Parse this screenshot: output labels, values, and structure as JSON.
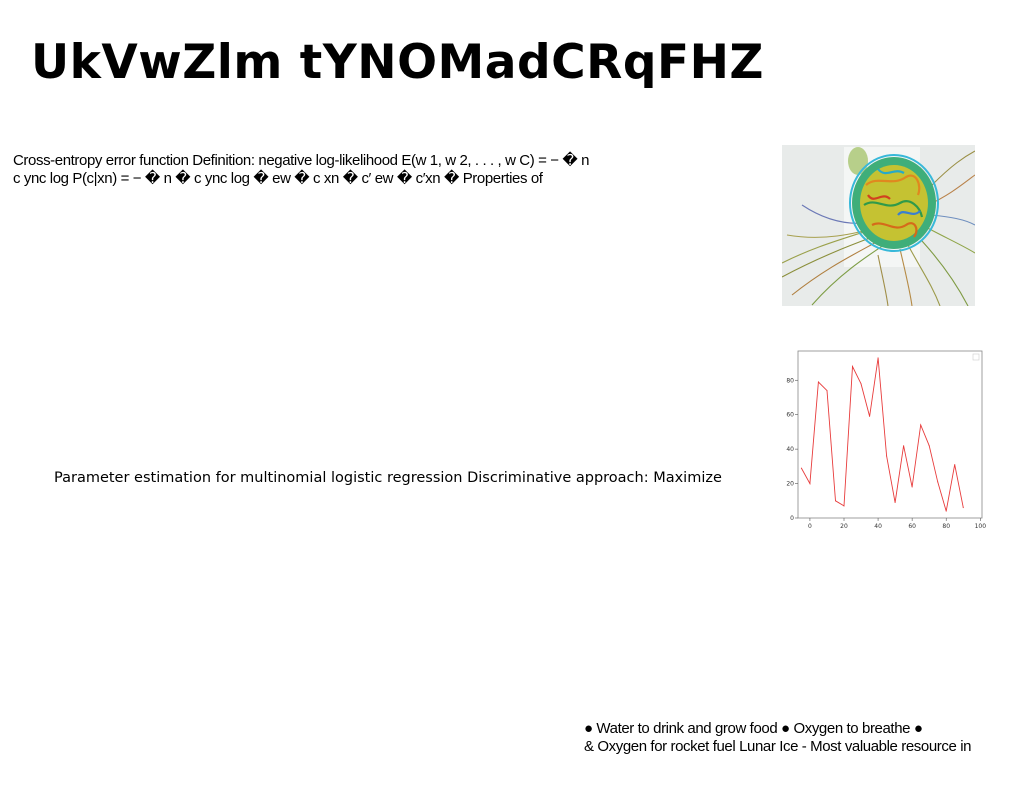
{
  "slide": {
    "title": "UkVwZlm tYNOMadCRqFHZ",
    "paragraph_1": {
      "line_1": "Cross-entropy error function Definition: negative log-likelihood E(w 1, w 2, . . . , w C) = − � n",
      "line_2": "c ync log P(c|xn) = − � n � c ync log � ew � c xn � c′ ew � c′xn � Properties of"
    },
    "paragraph_2": "Parameter estimation for multinomial logistic regression Discriminative approach: Maximize",
    "paragraph_3": {
      "line_1": "● Water to drink and grow food ● Oxygen to breathe ●",
      "line_2": "& Oxygen for rocket fuel Lunar Ice - Most valuable resource in"
    }
  },
  "chart_data": {
    "type": "line",
    "x": [
      -5,
      0,
      5,
      10,
      15,
      20,
      25,
      30,
      35,
      40,
      45,
      50,
      55,
      60,
      65,
      70,
      75,
      80,
      85,
      90,
      95,
      100
    ],
    "series": [
      {
        "values": [
          29,
          20,
          79,
          74,
          10,
          7,
          88,
          78,
          59,
          93,
          36,
          9,
          42,
          18,
          54,
          42,
          21,
          4,
          31,
          6
        ],
        "color": "#e83c3c"
      }
    ],
    "x_ticks": [
      "0",
      "20",
      "40",
      "60",
      "80",
      "100"
    ],
    "y_ticks": [
      "0",
      "20",
      "40",
      "60",
      "80"
    ],
    "xlim": [
      -7,
      101
    ],
    "ylim": [
      0,
      97
    ],
    "title": "",
    "xlabel": "",
    "ylabel": "",
    "grid": false,
    "legend": "top-right"
  }
}
